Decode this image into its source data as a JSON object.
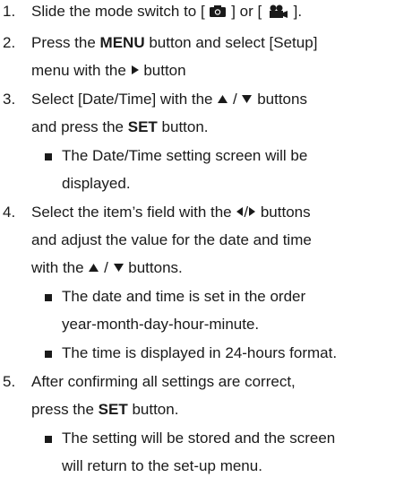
{
  "steps": [
    {
      "number": "1.",
      "parts": {
        "a": "Slide the mode switch to [",
        "b": "] or [",
        "c": "]."
      },
      "icons": [
        "camera-icon",
        "video-camera-icon"
      ]
    },
    {
      "number": "2.",
      "lines": {
        "l1a": "Press the ",
        "l1b": "MENU",
        "l1c": " button and select [Setup]",
        "l2a": "menu with the",
        "l2b": "button"
      }
    },
    {
      "number": "3.",
      "lines": {
        "l1a": "Select [Date/Time] with the",
        "l1b": "/",
        "l1c": "buttons",
        "l2a": "and press the ",
        "l2b": "SET",
        "l2c": " button."
      },
      "bullets": [
        {
          "l1": "The Date/Time setting screen will be",
          "l2": "displayed."
        }
      ]
    },
    {
      "number": "4.",
      "lines": {
        "l1a": "Select the item’s field with the",
        "l1b": "/",
        "l1c": "buttons",
        "l2": "and adjust the value for the date and time",
        "l3a": "with the",
        "l3b": "/",
        "l3c": "buttons."
      },
      "bullets": [
        {
          "l1": "The date and time is set in the order",
          "l2": "year-month-day-hour-minute."
        },
        {
          "l1": "The time is displayed in 24-hours format."
        }
      ]
    },
    {
      "number": "5.",
      "lines": {
        "l1": "After confirming all settings are correct,",
        "l2a": "press the ",
        "l2b": "SET",
        "l2c": " button."
      },
      "bullets": [
        {
          "l1": "The setting will be stored and the screen",
          "l2": "will return to the set-up menu."
        }
      ]
    }
  ]
}
